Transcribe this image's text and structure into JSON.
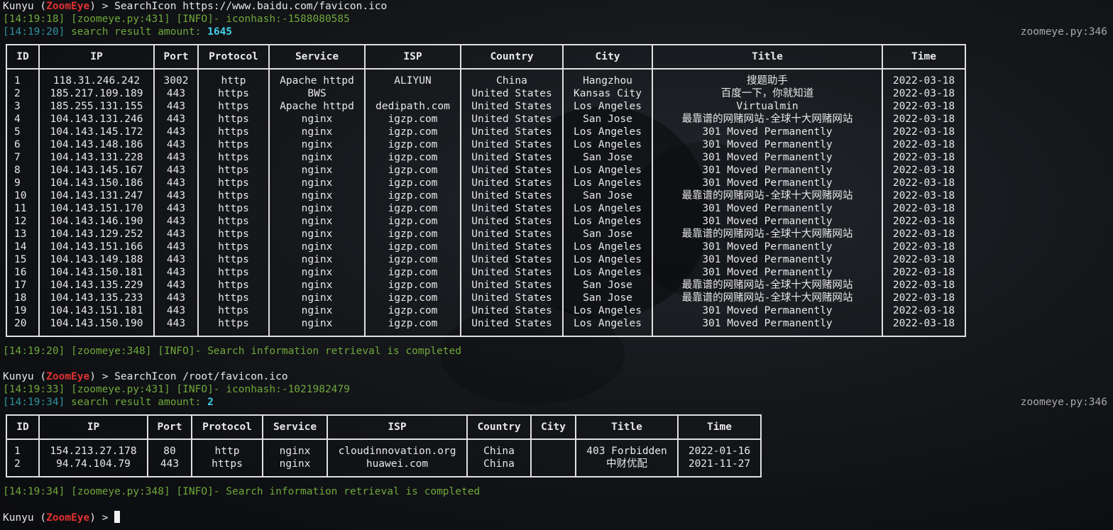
{
  "session1": {
    "prompt_user": "Kunyu",
    "prompt_app": "ZoomEye",
    "prompt_arrow": ">",
    "command": "SearchIcon https://www.baidu.com/favicon.ico",
    "hash_log": "[14:19:18] [zoomeye.py:431] [INFO]- iconhash:-1588080585",
    "amount_time": "[14:19:20]",
    "amount_label": "search result amount:",
    "amount_value": "1645",
    "source_ref": "zoomeye.py:346",
    "done_log": "[14:19:20] [zoomeye:348] [INFO]- Search information retrieval is completed"
  },
  "table1": {
    "headers": [
      "ID",
      "IP",
      "Port",
      "Protocol",
      "Service",
      "ISP",
      "Country",
      "City",
      "Title",
      "Time"
    ],
    "rows": [
      [
        "1",
        "118.31.246.242",
        "3002",
        "http",
        "Apache httpd",
        "ALIYUN",
        "China",
        "Hangzhou",
        "搜题助手",
        "2022-03-18"
      ],
      [
        "2",
        "185.217.109.189",
        "443",
        "https",
        "BWS",
        "",
        "United States",
        "Kansas City",
        "百度一下，你就知道",
        "2022-03-18"
      ],
      [
        "3",
        "185.255.131.155",
        "443",
        "https",
        "Apache httpd",
        "dedipath.com",
        "United States",
        "Los Angeles",
        "Virtualmin",
        "2022-03-18"
      ],
      [
        "4",
        "104.143.131.246",
        "443",
        "https",
        "nginx",
        "igzp.com",
        "United States",
        "San Jose",
        "最靠谱的网赌网站-全球十大网赌网站",
        "2022-03-18"
      ],
      [
        "5",
        "104.143.145.172",
        "443",
        "https",
        "nginx",
        "igzp.com",
        "United States",
        "Los Angeles",
        "301 Moved Permanently",
        "2022-03-18"
      ],
      [
        "6",
        "104.143.148.186",
        "443",
        "https",
        "nginx",
        "igzp.com",
        "United States",
        "Los Angeles",
        "301 Moved Permanently",
        "2022-03-18"
      ],
      [
        "7",
        "104.143.131.228",
        "443",
        "https",
        "nginx",
        "igzp.com",
        "United States",
        "San Jose",
        "301 Moved Permanently",
        "2022-03-18"
      ],
      [
        "8",
        "104.143.145.167",
        "443",
        "https",
        "nginx",
        "igzp.com",
        "United States",
        "Los Angeles",
        "301 Moved Permanently",
        "2022-03-18"
      ],
      [
        "9",
        "104.143.150.186",
        "443",
        "https",
        "nginx",
        "igzp.com",
        "United States",
        "Los Angeles",
        "301 Moved Permanently",
        "2022-03-18"
      ],
      [
        "10",
        "104.143.131.247",
        "443",
        "https",
        "nginx",
        "igzp.com",
        "United States",
        "San Jose",
        "最靠谱的网赌网站-全球十大网赌网站",
        "2022-03-18"
      ],
      [
        "11",
        "104.143.151.170",
        "443",
        "https",
        "nginx",
        "igzp.com",
        "United States",
        "Los Angeles",
        "301 Moved Permanently",
        "2022-03-18"
      ],
      [
        "12",
        "104.143.146.190",
        "443",
        "https",
        "nginx",
        "igzp.com",
        "United States",
        "Los Angeles",
        "301 Moved Permanently",
        "2022-03-18"
      ],
      [
        "13",
        "104.143.129.252",
        "443",
        "https",
        "nginx",
        "igzp.com",
        "United States",
        "San Jose",
        "最靠谱的网赌网站-全球十大网赌网站",
        "2022-03-18"
      ],
      [
        "14",
        "104.143.151.166",
        "443",
        "https",
        "nginx",
        "igzp.com",
        "United States",
        "Los Angeles",
        "301 Moved Permanently",
        "2022-03-18"
      ],
      [
        "15",
        "104.143.149.188",
        "443",
        "https",
        "nginx",
        "igzp.com",
        "United States",
        "Los Angeles",
        "301 Moved Permanently",
        "2022-03-18"
      ],
      [
        "16",
        "104.143.150.181",
        "443",
        "https",
        "nginx",
        "igzp.com",
        "United States",
        "Los Angeles",
        "301 Moved Permanently",
        "2022-03-18"
      ],
      [
        "17",
        "104.143.135.229",
        "443",
        "https",
        "nginx",
        "igzp.com",
        "United States",
        "San Jose",
        "最靠谱的网赌网站-全球十大网赌网站",
        "2022-03-18"
      ],
      [
        "18",
        "104.143.135.233",
        "443",
        "https",
        "nginx",
        "igzp.com",
        "United States",
        "San Jose",
        "最靠谱的网赌网站-全球十大网赌网站",
        "2022-03-18"
      ],
      [
        "19",
        "104.143.151.181",
        "443",
        "https",
        "nginx",
        "igzp.com",
        "United States",
        "Los Angeles",
        "301 Moved Permanently",
        "2022-03-18"
      ],
      [
        "20",
        "104.143.150.190",
        "443",
        "https",
        "nginx",
        "igzp.com",
        "United States",
        "Los Angeles",
        "301 Moved Permanently",
        "2022-03-18"
      ]
    ]
  },
  "session2": {
    "prompt_user": "Kunyu",
    "prompt_app": "ZoomEye",
    "prompt_arrow": ">",
    "command": "SearchIcon /root/favicon.ico",
    "hash_log": "[14:19:33] [zoomeye.py:431] [INFO]- iconhash:-1021982479",
    "amount_time": "[14:19:34]",
    "amount_label": "search result amount:",
    "amount_value": "2",
    "source_ref": "zoomeye.py:346",
    "done_log": "[14:19:34] [zoomeye.py:348] [INFO]- Search information retrieval is completed"
  },
  "table2": {
    "headers": [
      "ID",
      "IP",
      "Port",
      "Protocol",
      "Service",
      "ISP",
      "Country",
      "City",
      "Title",
      "Time"
    ],
    "rows": [
      [
        "1",
        "154.213.27.178",
        "80",
        "http",
        "nginx",
        "cloudinnovation.org",
        "China",
        "",
        "403 Forbidden",
        "2022-01-16"
      ],
      [
        "2",
        "94.74.104.79",
        "443",
        "https",
        "nginx",
        "huawei.com",
        "China",
        "",
        "中财优配",
        "2021-11-27"
      ]
    ]
  },
  "prompt3": {
    "prompt_user": "Kunyu",
    "prompt_app": "ZoomEye",
    "prompt_arrow": ">"
  },
  "colors": {
    "background": "#0e1013",
    "prompt_app": "#e03131",
    "log_green": "#6fa83a",
    "amount_time": "#2e93a0",
    "amount_value": "#3fd0e8",
    "table_border": "#e0e0e0"
  }
}
